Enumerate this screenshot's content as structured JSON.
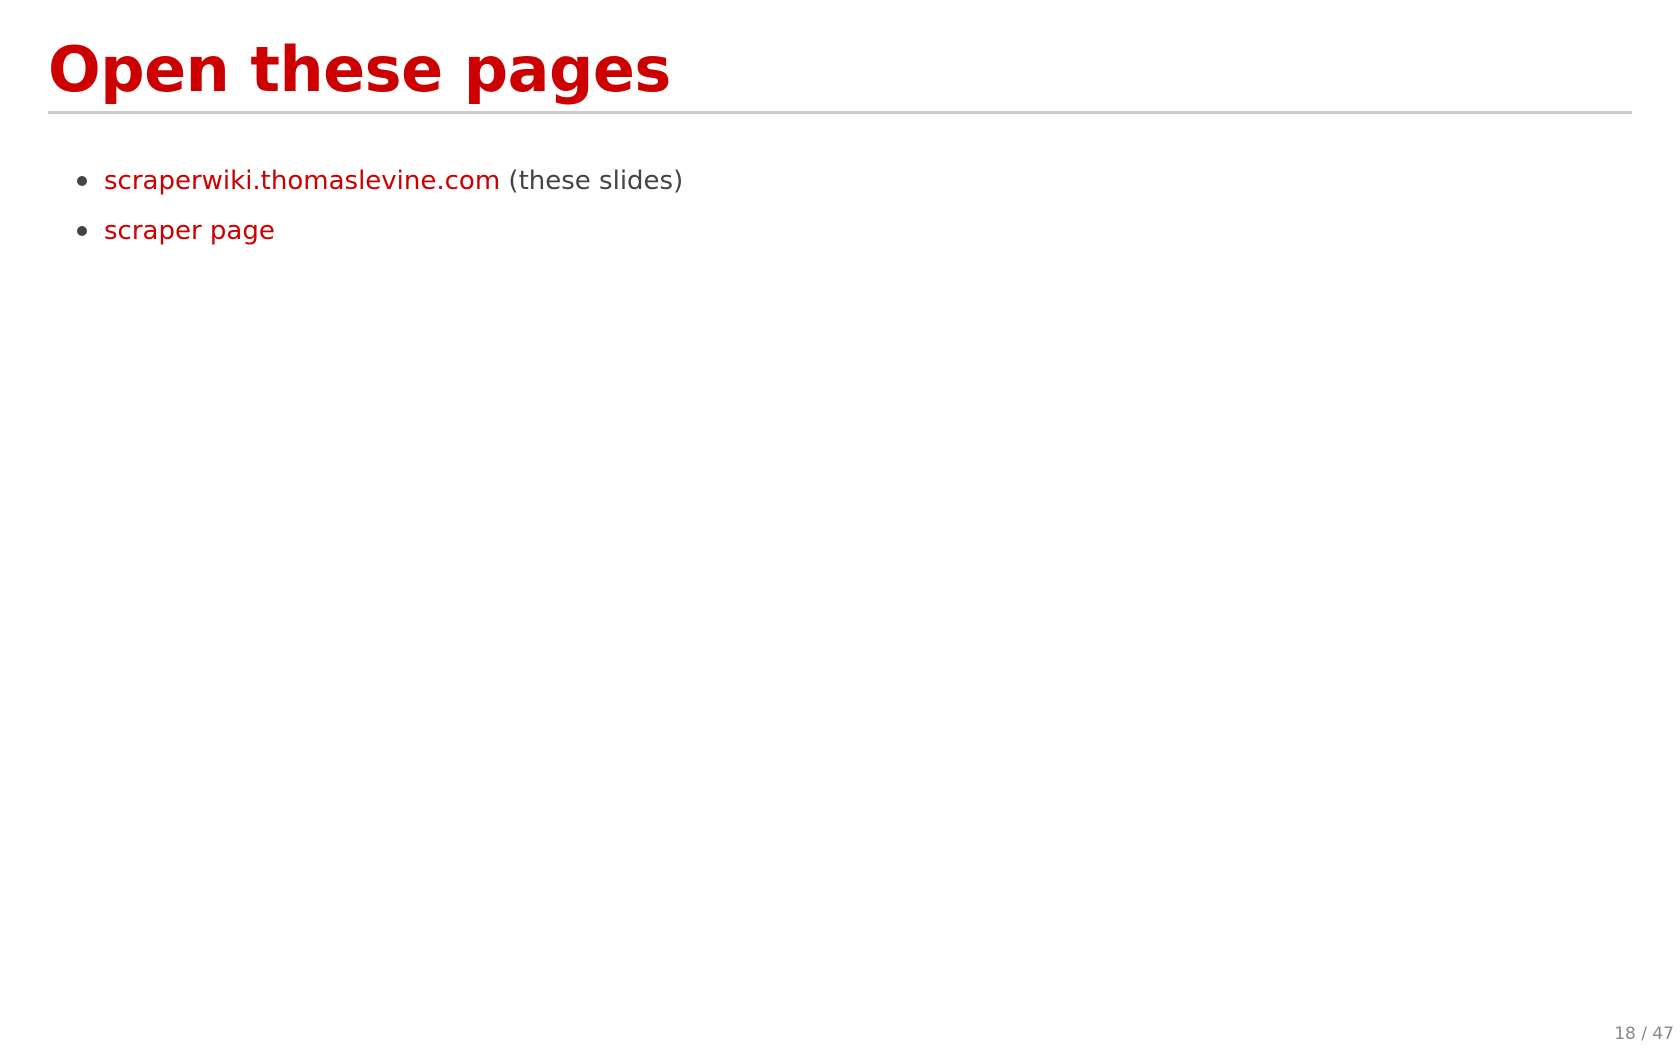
{
  "slide": {
    "title": "Open these pages",
    "items": [
      {
        "link_text": "scraperwiki.thomaslevine.com",
        "note": " (these slides)"
      },
      {
        "link_text": "scraper page",
        "note": ""
      }
    ],
    "page_counter": "18 / 47"
  },
  "colors": {
    "accent": "#cc0000",
    "text": "#444444",
    "rule": "#cccccc",
    "counter": "#888888"
  }
}
